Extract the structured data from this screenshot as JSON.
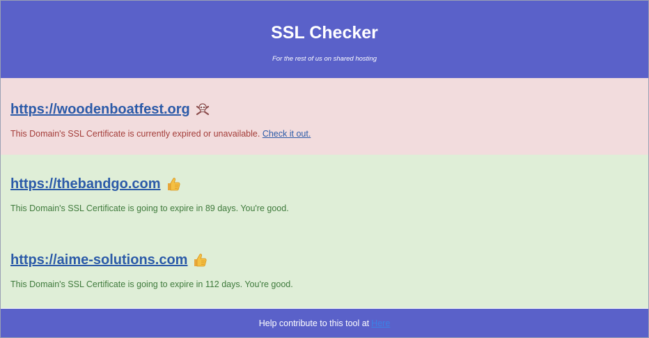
{
  "header": {
    "title": "SSL Checker",
    "subtitle": "For the rest of us on shared hosting"
  },
  "sites": [
    {
      "url": "https://woodenboatfest.org",
      "status": "expired",
      "icon": "skull-and-crossbones-icon",
      "message": "This Domain's SSL Certificate is currently expired or unavailable.",
      "link_label": "Check it out."
    },
    {
      "url": "https://thebandgo.com",
      "status": "valid",
      "icon": "thumbs-up-icon",
      "message": "This Domain's SSL Certificate is going to expire in 89 days. You're good."
    },
    {
      "url": "https://aime-solutions.com",
      "status": "valid",
      "icon": "thumbs-up-icon",
      "message": "This Domain's SSL Certificate is going to expire in 112 days. You're good."
    }
  ],
  "footer": {
    "text": "Help contribute to this tool at",
    "link_label": "Here"
  },
  "colors": {
    "header_bg": "#5a61c9",
    "expired_bg": "#f2dcdd",
    "expired_text": "#a33c38",
    "valid_bg": "#dfeed7",
    "valid_text": "#3f7a3c",
    "link": "#2b5aa8"
  }
}
